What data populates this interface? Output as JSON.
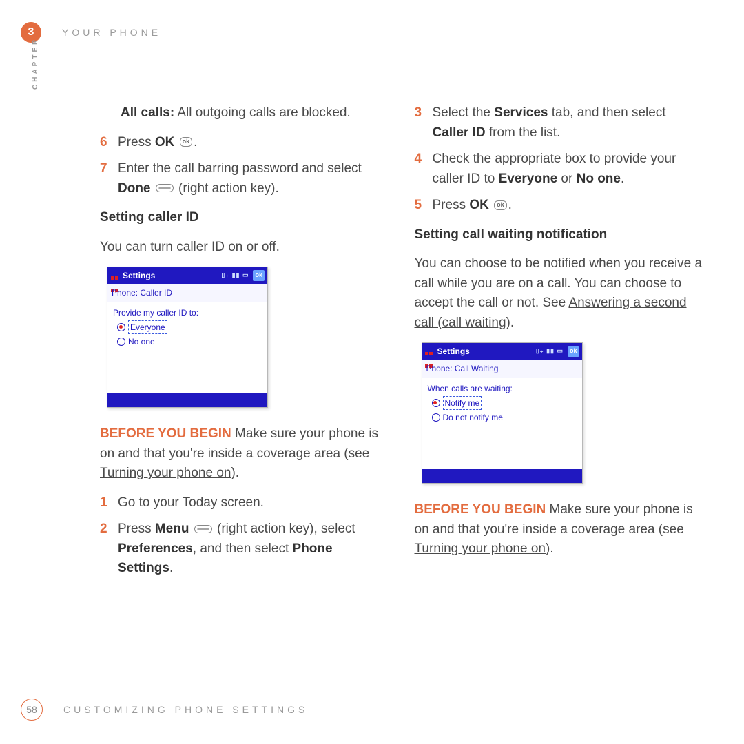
{
  "chapter": {
    "number": "3",
    "badge_label": "CHAPTER",
    "section": "YOUR PHONE"
  },
  "left": {
    "all_calls_label": "All calls:",
    "all_calls_text": " All outgoing calls are blocked.",
    "step6_num": "6",
    "step6_text_a": "Press ",
    "step6_text_b": "OK",
    "step6_text_c": " ",
    "step6_text_d": ".",
    "step7_num": "7",
    "step7_text_a": "Enter the call barring password and select ",
    "step7_text_b": "Done",
    "step7_text_c": " ",
    "step7_text_d": " (right action key).",
    "head1": "Setting caller ID",
    "head1_desc": "You can turn caller ID on or off.",
    "shot1": {
      "title": "Settings",
      "okbox": "ok",
      "breadcrumb": "Phone:  Caller ID",
      "prompt": "Provide my caller ID to:",
      "opt1": "Everyone",
      "opt2": "No one"
    },
    "byb": "BEFORE YOU BEGIN",
    "byb_text_a": "  Make sure your phone is on and that you're inside a coverage area (see ",
    "byb_link": "Turning your phone on",
    "byb_text_b": ").",
    "step1_num": "1",
    "step1_text": "Go to your Today screen.",
    "step2_num": "2",
    "step2_text_a": "Press ",
    "step2_text_b": "Menu",
    "step2_text_c": " ",
    "step2_text_d": " (right action key), select ",
    "step2_text_e": "Preferences",
    "step2_text_f": ", and then select ",
    "step2_text_g": "Phone Settings",
    "step2_text_h": "."
  },
  "right": {
    "step3_num": "3",
    "step3_text_a": "Select the ",
    "step3_text_b": "Services",
    "step3_text_c": " tab, and then select ",
    "step3_text_d": "Caller ID",
    "step3_text_e": " from the list.",
    "step4_num": "4",
    "step4_text_a": "Check the appropriate box to provide your caller ID to ",
    "step4_text_b": "Everyone",
    "step4_text_c": " or ",
    "step4_text_d": "No one",
    "step4_text_e": ".",
    "step5_num": "5",
    "step5_text_a": "Press ",
    "step5_text_b": "OK",
    "step5_text_c": " ",
    "step5_text_d": ".",
    "head2": "Setting call waiting notification",
    "head2_desc_a": "You can choose to be notified when you receive a call while you are on a call. You can choose to accept the call or not. See ",
    "head2_link": "Answering a second call (call waiting)",
    "head2_desc_b": ".",
    "shot2": {
      "title": "Settings",
      "okbox": "ok",
      "breadcrumb": "Phone:  Call Waiting",
      "prompt": "When calls are waiting:",
      "opt1": "Notify me",
      "opt2": "Do not notify me"
    },
    "byb": "BEFORE YOU BEGIN",
    "byb_text_a": "  Make sure your phone is on and that you're inside a coverage area (see ",
    "byb_link": "Turning your phone on",
    "byb_text_b": ")."
  },
  "footer": {
    "page_number": "58",
    "section": "CUSTOMIZING PHONE SETTINGS"
  }
}
